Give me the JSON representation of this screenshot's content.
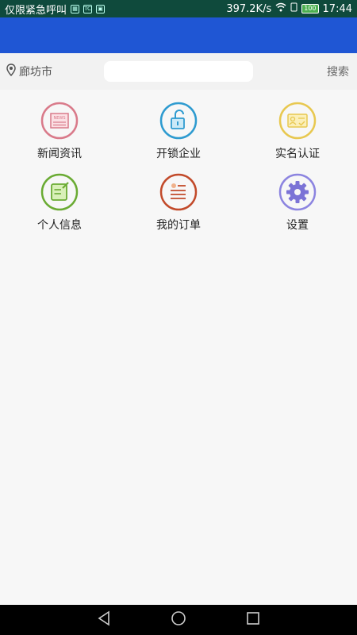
{
  "status_bar": {
    "carrier_text": "仅限紧急呼叫",
    "network_speed": "397.2K/s",
    "battery_level": "100",
    "time": "17:44"
  },
  "location": {
    "city": "廊坊市"
  },
  "search": {
    "placeholder": "",
    "button_label": "搜索"
  },
  "menu": [
    {
      "label": "新闻资讯",
      "icon": "news-icon",
      "color": "#d97a8a"
    },
    {
      "label": "开锁企业",
      "icon": "unlock-icon",
      "color": "#2e9bd0"
    },
    {
      "label": "实名认证",
      "icon": "id-card-icon",
      "color": "#e8c850"
    },
    {
      "label": "个人信息",
      "icon": "edit-note-icon",
      "color": "#6aab33"
    },
    {
      "label": "我的订单",
      "icon": "order-list-icon",
      "color": "#c24a2a"
    },
    {
      "label": "设置",
      "icon": "gear-icon",
      "color": "#8c84e0"
    }
  ],
  "colors": {
    "app_bar": "#1f56d4",
    "status_bar": "#0f4a3c",
    "background": "#f7f7f7"
  }
}
